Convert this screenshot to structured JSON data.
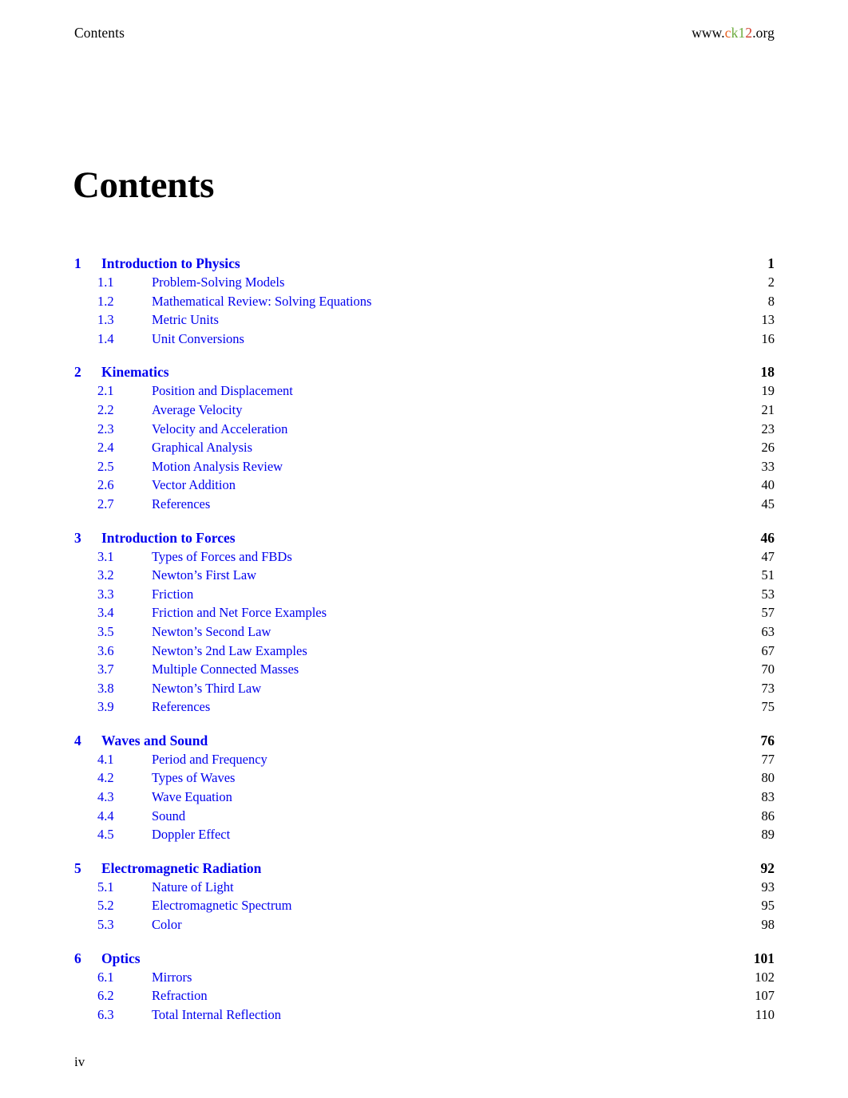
{
  "header": {
    "left_text": "Contents",
    "site": {
      "prefix": "www.",
      "c": "c",
      "k": "k",
      "one": "1",
      "two": "2",
      "suffix": ".org"
    },
    "colors": {
      "c": "#E8601C",
      "k": "#6AAA3A",
      "one": "#6AAA3A",
      "two": "#D13B2A",
      "link_blue": "#0000EE",
      "text_black": "#000000"
    }
  },
  "page_title": "Contents",
  "footer": {
    "page_number": "iv"
  },
  "toc": {
    "chapters": [
      {
        "number": "1",
        "title": "Introduction to Physics",
        "page": "1",
        "sections": [
          {
            "number": "1.1",
            "title": "Problem-Solving Models",
            "page": "2"
          },
          {
            "number": "1.2",
            "title": "Mathematical Review: Solving Equations",
            "page": "8"
          },
          {
            "number": "1.3",
            "title": "Metric Units",
            "page": "13"
          },
          {
            "number": "1.4",
            "title": "Unit Conversions",
            "page": "16"
          }
        ]
      },
      {
        "number": "2",
        "title": "Kinematics",
        "page": "18",
        "sections": [
          {
            "number": "2.1",
            "title": "Position and Displacement",
            "page": "19"
          },
          {
            "number": "2.2",
            "title": "Average Velocity",
            "page": "21"
          },
          {
            "number": "2.3",
            "title": "Velocity and Acceleration",
            "page": "23"
          },
          {
            "number": "2.4",
            "title": "Graphical Analysis",
            "page": "26"
          },
          {
            "number": "2.5",
            "title": "Motion Analysis Review",
            "page": "33"
          },
          {
            "number": "2.6",
            "title": "Vector Addition",
            "page": "40"
          },
          {
            "number": "2.7",
            "title": "References",
            "page": "45"
          }
        ]
      },
      {
        "number": "3",
        "title": "Introduction to Forces",
        "page": "46",
        "sections": [
          {
            "number": "3.1",
            "title": "Types of Forces and FBDs",
            "page": "47"
          },
          {
            "number": "3.2",
            "title": "Newton’s First Law",
            "page": "51"
          },
          {
            "number": "3.3",
            "title": "Friction",
            "page": "53"
          },
          {
            "number": "3.4",
            "title": "Friction and Net Force Examples",
            "page": "57"
          },
          {
            "number": "3.5",
            "title": "Newton’s Second Law",
            "page": "63"
          },
          {
            "number": "3.6",
            "title": "Newton’s 2nd Law Examples",
            "page": "67"
          },
          {
            "number": "3.7",
            "title": "Multiple Connected Masses",
            "page": "70"
          },
          {
            "number": "3.8",
            "title": "Newton’s Third Law",
            "page": "73"
          },
          {
            "number": "3.9",
            "title": "References",
            "page": "75"
          }
        ]
      },
      {
        "number": "4",
        "title": "Waves and Sound",
        "page": "76",
        "sections": [
          {
            "number": "4.1",
            "title": "Period and Frequency",
            "page": "77"
          },
          {
            "number": "4.2",
            "title": "Types of Waves",
            "page": "80"
          },
          {
            "number": "4.3",
            "title": "Wave Equation",
            "page": "83"
          },
          {
            "number": "4.4",
            "title": "Sound",
            "page": "86"
          },
          {
            "number": "4.5",
            "title": "Doppler Effect",
            "page": "89"
          }
        ]
      },
      {
        "number": "5",
        "title": "Electromagnetic Radiation",
        "page": "92",
        "sections": [
          {
            "number": "5.1",
            "title": "Nature of Light",
            "page": "93"
          },
          {
            "number": "5.2",
            "title": "Electromagnetic Spectrum",
            "page": "95"
          },
          {
            "number": "5.3",
            "title": "Color",
            "page": "98"
          }
        ]
      },
      {
        "number": "6",
        "title": "Optics",
        "page": "101",
        "sections": [
          {
            "number": "6.1",
            "title": "Mirrors",
            "page": "102"
          },
          {
            "number": "6.2",
            "title": "Refraction",
            "page": "107"
          },
          {
            "number": "6.3",
            "title": "Total Internal Reflection",
            "page": "110"
          }
        ]
      }
    ]
  }
}
